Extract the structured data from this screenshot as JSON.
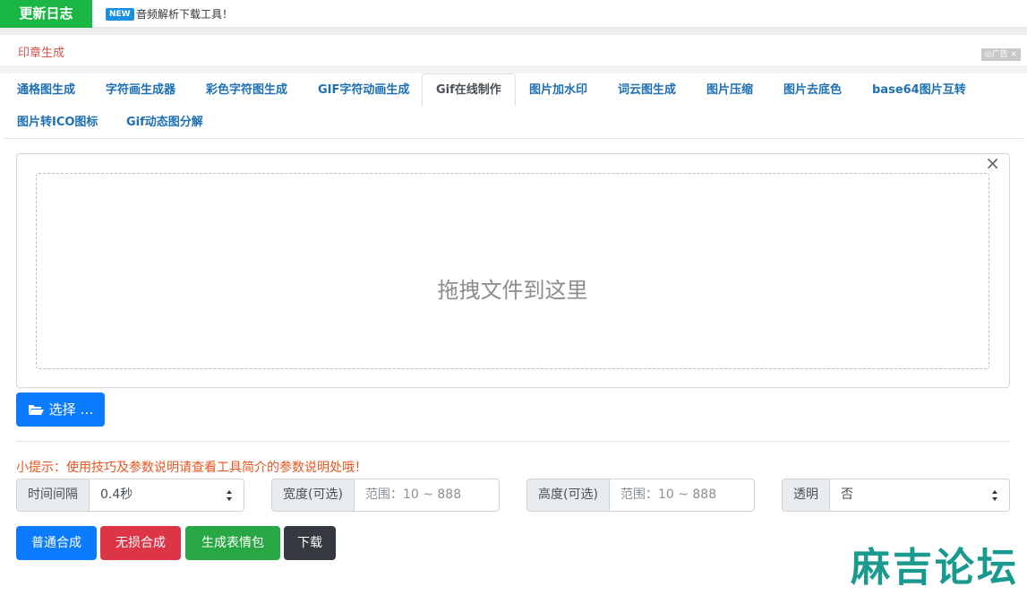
{
  "topbar": {
    "changelog_label": "更新日志",
    "new_badge": "NEW",
    "news_text": "音频解析下载工具！"
  },
  "subbar": {
    "title": "印章生成",
    "ad_label": "广告"
  },
  "tabs": [
    {
      "label": "通格图生成"
    },
    {
      "label": "字符画生成器"
    },
    {
      "label": "彩色字符图生成"
    },
    {
      "label": "GIF字符动画生成"
    },
    {
      "label": "Gif在线制作",
      "active": true
    },
    {
      "label": "图片加水印"
    },
    {
      "label": "词云图生成"
    },
    {
      "label": "图片压缩"
    },
    {
      "label": "图片去底色"
    },
    {
      "label": "base64图片互转"
    },
    {
      "label": "图片转ICO图标"
    },
    {
      "label": "Gif动态图分解"
    }
  ],
  "upload": {
    "close_glyph": "×",
    "drop_text": "拖拽文件到这里",
    "select_label": "选择 …"
  },
  "tip": "小提示：使用技巧及参数说明请查看工具简介的参数说明处哦！",
  "options": {
    "interval": {
      "label": "时间间隔",
      "value": "0.4秒"
    },
    "width": {
      "label": "宽度(可选)",
      "placeholder": "范围：10 ~ 888"
    },
    "height": {
      "label": "高度(可选)",
      "placeholder": "范围：10 ~ 888"
    },
    "transparent": {
      "label": "透明",
      "value": "否"
    }
  },
  "actions": {
    "normal": "普通合成",
    "lossless": "无损合成",
    "emoji": "生成表情包",
    "download": "下载"
  },
  "watermark": "麻吉论坛",
  "colors": {
    "green": "#1bb744",
    "primary": "#0b7bff",
    "danger": "#dc3545",
    "success": "#28a745",
    "dark": "#343a40",
    "tip": "#e8541d",
    "tab_link": "#1e6fb3"
  }
}
